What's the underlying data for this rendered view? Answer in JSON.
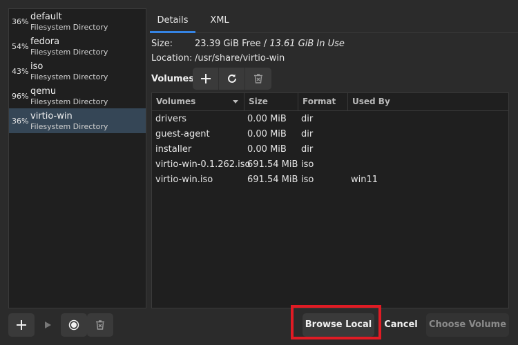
{
  "pools": [
    {
      "percent": "36%",
      "name": "default",
      "type": "Filesystem Directory",
      "selected": false
    },
    {
      "percent": "54%",
      "name": "fedora",
      "type": "Filesystem Directory",
      "selected": false
    },
    {
      "percent": "43%",
      "name": "iso",
      "type": "Filesystem Directory",
      "selected": false
    },
    {
      "percent": "96%",
      "name": "qemu",
      "type": "Filesystem Directory",
      "selected": false
    },
    {
      "percent": "36%",
      "name": "virtio-win",
      "type": "Filesystem Directory",
      "selected": true
    }
  ],
  "pool_toolbar": {
    "icons": [
      "add-icon",
      "play-icon",
      "stop-icon",
      "delete-icon"
    ]
  },
  "tabs": [
    {
      "label": "Details",
      "active": true
    },
    {
      "label": "XML",
      "active": false
    }
  ],
  "details": {
    "size_label": "Size:",
    "size_free": "23.39 GiB Free / ",
    "size_in_use": "13.61 GiB In Use",
    "location_label": "Location:",
    "location_value": "/usr/share/virtio-win"
  },
  "volumes": {
    "label": "Volumes",
    "toolbar_icons": [
      "add-icon",
      "refresh-icon",
      "delete-icon"
    ],
    "columns": [
      "Volumes",
      "Size",
      "Format",
      "Used By"
    ],
    "rows": [
      {
        "name": "drivers",
        "size": "0.00 MiB",
        "format": "dir",
        "used_by": ""
      },
      {
        "name": "guest-agent",
        "size": "0.00 MiB",
        "format": "dir",
        "used_by": ""
      },
      {
        "name": "installer",
        "size": "0.00 MiB",
        "format": "dir",
        "used_by": ""
      },
      {
        "name": "virtio-win-0.1.262.iso",
        "size": "691.54 MiB",
        "format": "iso",
        "used_by": ""
      },
      {
        "name": "virtio-win.iso",
        "size": "691.54 MiB",
        "format": "iso",
        "used_by": "win11"
      }
    ]
  },
  "buttons": {
    "browse_local": "Browse Local",
    "cancel": "Cancel",
    "choose_volume": "Choose Volume"
  },
  "colors": {
    "background": "#2b2b2b",
    "list_background": "#1f1f1f",
    "selected_row": "#354656",
    "accent": "#3584e4",
    "highlight": "#e01b24"
  }
}
